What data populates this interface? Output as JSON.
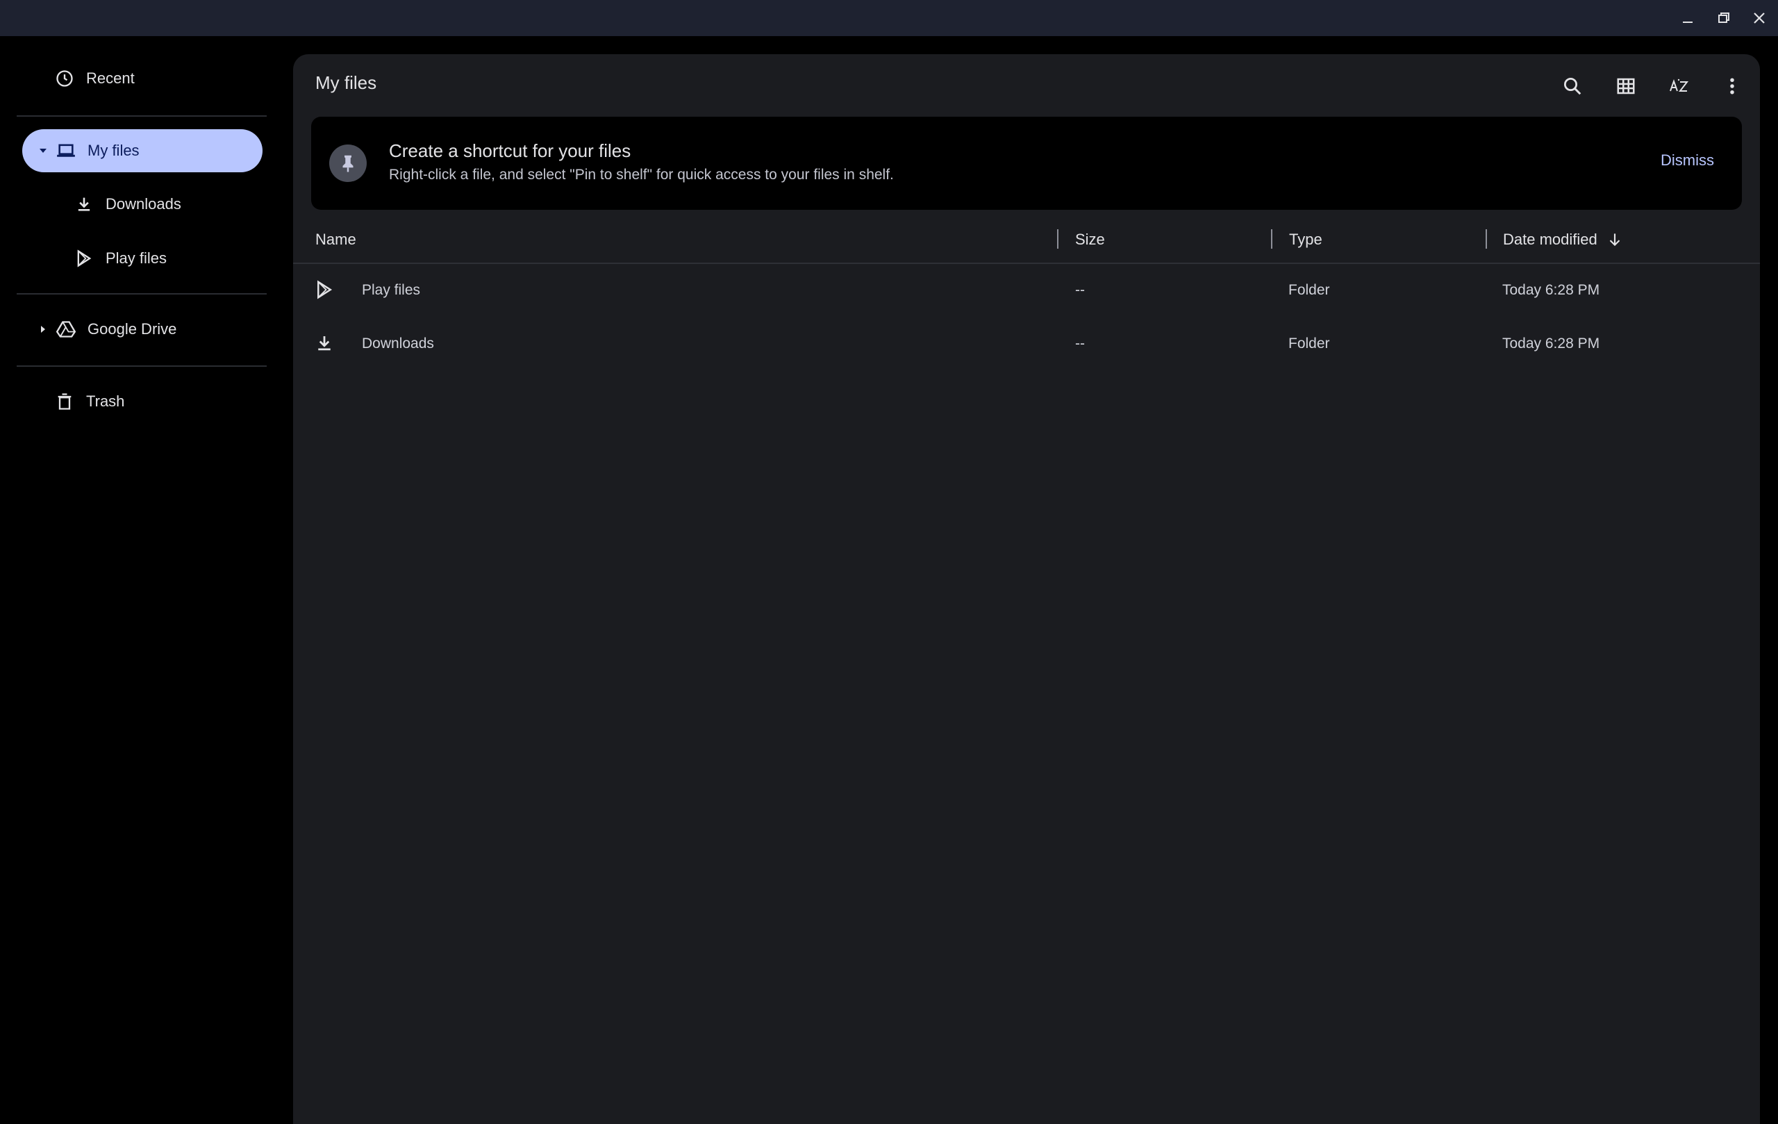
{
  "window": {
    "controls": [
      {
        "name": "minimize-button",
        "icon": "minimize-icon"
      },
      {
        "name": "restore-button",
        "icon": "restore-icon"
      },
      {
        "name": "close-button",
        "icon": "close-icon"
      }
    ]
  },
  "sidebar": {
    "recent": {
      "label": "Recent",
      "icon": "clock-icon"
    },
    "my_files": {
      "label": "My files",
      "icon": "laptop-icon",
      "expanded": true,
      "selected": true
    },
    "downloads": {
      "label": "Downloads",
      "icon": "download-icon"
    },
    "play_files": {
      "label": "Play files",
      "icon": "play-store-icon"
    },
    "google_drive": {
      "label": "Google Drive",
      "icon": "drive-icon",
      "expanded": false
    },
    "trash": {
      "label": "Trash",
      "icon": "trash-icon"
    }
  },
  "header": {
    "title": "My files",
    "tools": [
      "search-icon",
      "grid-view-icon",
      "sort-az-icon",
      "more-vert-icon"
    ]
  },
  "banner": {
    "title": "Create a shortcut for your files",
    "subtitle": "Right-click a file, and select \"Pin to shelf\" for quick access to your files in shelf.",
    "dismiss_label": "Dismiss",
    "icon": "pin-icon"
  },
  "table": {
    "columns": {
      "name": "Name",
      "size": "Size",
      "type": "Type",
      "date": "Date modified"
    },
    "sort_icon": "arrow-down-icon",
    "rows": [
      {
        "name": "Play files",
        "size": "--",
        "type": "Folder",
        "date": "Today 6:28 PM",
        "icon": "play-store-icon"
      },
      {
        "name": "Downloads",
        "size": "--",
        "type": "Folder",
        "date": "Today 6:28 PM",
        "icon": "download-icon"
      }
    ]
  },
  "colors": {
    "titlebar": "#1e2230",
    "sidebar_bg": "#000000",
    "main_bg": "#1b1c20",
    "selected_bg": "#b8c6ff",
    "accent": "#b8c6ff"
  }
}
